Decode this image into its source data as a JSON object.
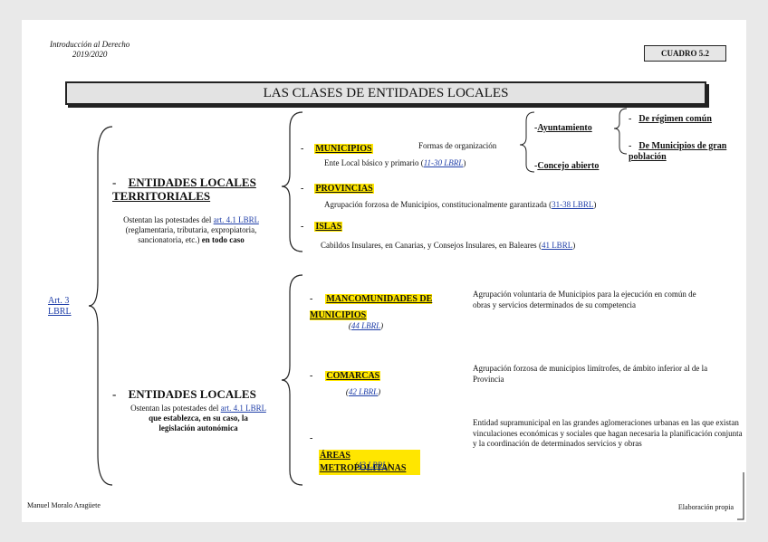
{
  "header": {
    "course": "Introducción al Derecho",
    "year": "2019/2020",
    "cuadro": "CUADRO 5.2"
  },
  "title": "LAS CLASES DE ENTIDADES LOCALES",
  "root_link": "Art. 3 LBRL",
  "territorial": {
    "bullet": "-",
    "title": "ENTIDADES LOCALES TERRITORIALES",
    "desc_prefix": "Ostentan las potestades del",
    "desc_link": "art. 4.1 LBRL",
    "desc_middle": "(reglamentaria, tributaria, expropiatoria, sancionatoria, etc.)",
    "desc_bold": "en todo caso",
    "items": {
      "municipios": {
        "label": "MUNICIPIOS",
        "org_label": "Formas de organización",
        "desc": "Ente Local básico y primario (",
        "link": "11-30 LBRL",
        "close": ")"
      },
      "provincias": {
        "label": "PROVINCIAS",
        "desc": "Agrupación forzosa de Municipios, constitucionalmente garantizada (",
        "link": "31-38 LBRL",
        "close": ")"
      },
      "islas": {
        "label": "ISLAS",
        "desc": "Cabildos Insulares, en Canarias, y Consejos Insulares, en Baleares (",
        "link": "41 LBRL",
        "close": ")"
      }
    },
    "org_forms": {
      "ayuntamiento": "Ayuntamiento",
      "concejo": "Concejo abierto",
      "regimen_comun": "De régimen común",
      "gran_poblacion": "De Municipios de gran población"
    }
  },
  "other": {
    "bullet": "-",
    "title": "ENTIDADES LOCALES",
    "desc_prefix": "Ostentan las potestades del",
    "desc_link": "art. 4.1 LBRL",
    "desc_bold": "que establezca, en su caso, la legislación autonómica",
    "items": {
      "mancomunidades": {
        "label": "MANCOMUNIDADES DE MUNICIPIOS",
        "link": "44 LBRL",
        "desc": "Agrupación voluntaria de Municipios para la ejecución en común de obras y servicios determinados de su competencia"
      },
      "comarcas": {
        "label": "COMARCAS",
        "link": "42 LBRL",
        "desc": "Agrupación forzosa de municipios limítrofes, de ámbito inferior al de la Provincia"
      },
      "areas": {
        "label": "ÁREAS METROPOLITANAS",
        "link": "43 LBRL",
        "desc": "Entidad supramunicipal en las grandes aglomeraciones urbanas en las que existan vinculaciones económicas y sociales que hagan necesaria la planificación conjunta y la coordinación de determinados servicios y obras"
      }
    }
  },
  "footer": {
    "author": "Manuel Moralo Aragüete",
    "source": "Elaboración propia"
  }
}
